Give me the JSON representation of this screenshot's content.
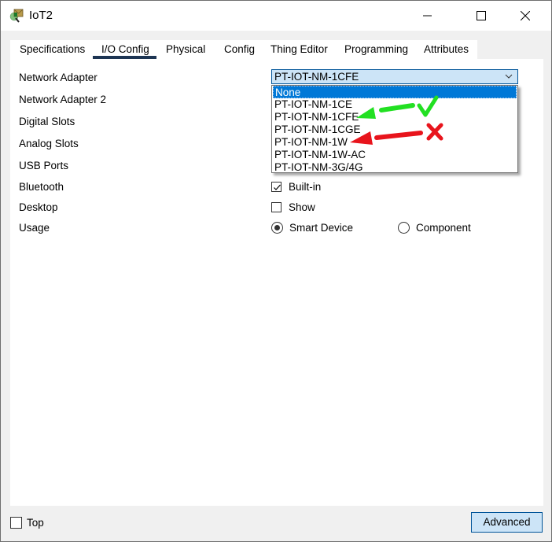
{
  "window": {
    "title": "IoT2",
    "icon": "packet-tracer-device-icon",
    "controls": [
      "minimize-icon",
      "maximize-icon",
      "close-icon"
    ]
  },
  "tabs": [
    {
      "label": "Specifications",
      "active": false
    },
    {
      "label": "I/O Config",
      "active": true
    },
    {
      "label": "Physical",
      "active": false
    },
    {
      "label": "Config",
      "active": false
    },
    {
      "label": "Thing Editor",
      "active": false
    },
    {
      "label": "Programming",
      "active": false
    },
    {
      "label": "Attributes",
      "active": false
    }
  ],
  "io_config": {
    "labels": [
      "Network Adapter",
      "Network Adapter 2",
      "Digital Slots",
      "Analog Slots",
      "USB Ports",
      "Bluetooth",
      "Desktop",
      "Usage"
    ],
    "network_adapter": {
      "selected": "PT-IOT-NM-1CFE",
      "options": [
        "None",
        "PT-IOT-NM-1CE",
        "PT-IOT-NM-1CFE",
        "PT-IOT-NM-1CGE",
        "PT-IOT-NM-1W",
        "PT-IOT-NM-1W-AC",
        "PT-IOT-NM-3G/4G"
      ],
      "highlighted": "None"
    },
    "bluetooth": {
      "label": "Built-in",
      "checked": true
    },
    "desktop": {
      "label": "Show",
      "checked": false
    },
    "usage": {
      "options": [
        {
          "label": "Smart Device",
          "selected": true
        },
        {
          "label": "Component",
          "selected": false
        }
      ]
    }
  },
  "annotations": {
    "green_arrow_target": "PT-IOT-NM-1CFE",
    "green_mark": "checkmark",
    "red_arrow_target": "PT-IOT-NM-1W",
    "red_mark": "cross",
    "colors": {
      "green": "#22e022",
      "red": "#e8141c"
    }
  },
  "footer": {
    "top_checkbox": {
      "label": "Top",
      "checked": false
    },
    "advanced_button": "Advanced"
  }
}
